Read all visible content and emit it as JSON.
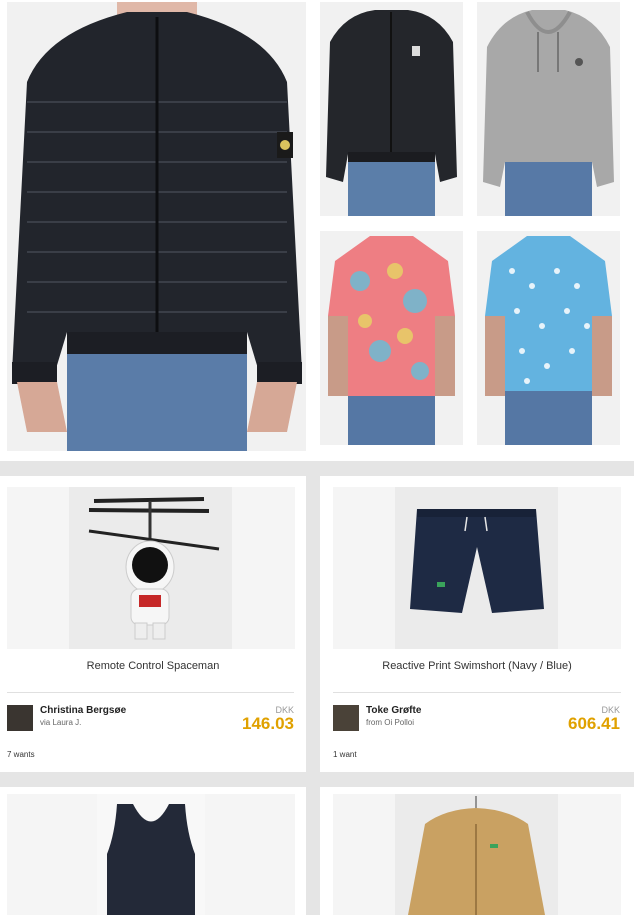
{
  "collage": {
    "tiles": [
      {
        "name": "down-jacket-photo"
      },
      {
        "name": "black-hooded-jacket-photo"
      },
      {
        "name": "grey-hoodie-photo"
      },
      {
        "name": "pink-print-shirt-photo"
      },
      {
        "name": "blue-dot-shirt-photo"
      }
    ]
  },
  "products": [
    {
      "title": "Remote Control Spaceman",
      "user": "Christina Bergsøe",
      "source": "via Laura J.",
      "currency": "DKK",
      "price": "146.03",
      "wants": "7 wants"
    },
    {
      "title": "Reactive Print Swimshort (Navy / Blue)",
      "user": "Toke Grøfte",
      "source": "from Oi Polloi",
      "currency": "DKK",
      "price": "606.41",
      "wants": "1 want"
    }
  ]
}
